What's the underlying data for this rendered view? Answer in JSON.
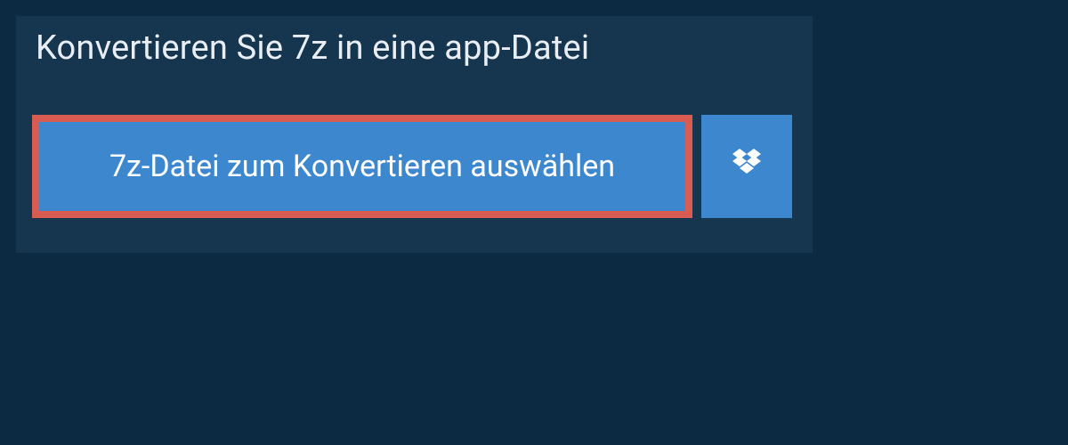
{
  "title": "Konvertieren Sie 7z in eine app-Datei",
  "select_file_label": "7z-Datei zum Konvertieren auswählen"
}
